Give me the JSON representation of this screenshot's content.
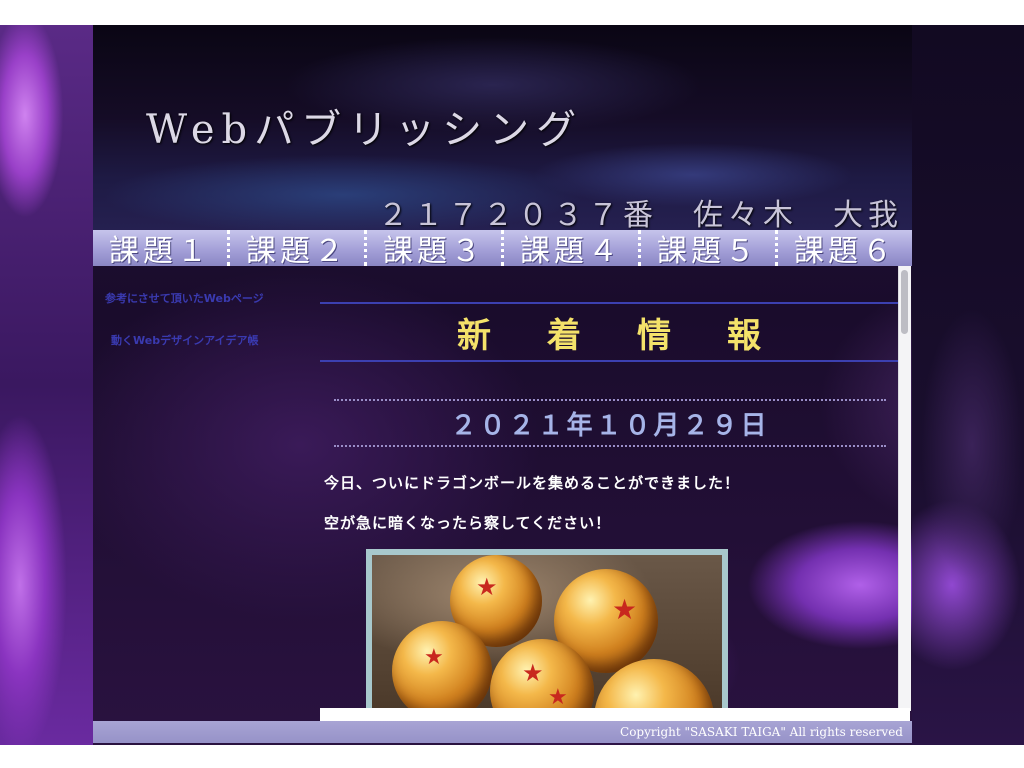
{
  "header": {
    "site_title": "Webパブリッシング",
    "student_info": "２１７２０３７番　佐々木　大我"
  },
  "nav": {
    "tabs": [
      "課題１",
      "課題２",
      "課題３",
      "課題４",
      "課題５",
      "課題６"
    ]
  },
  "sidebar": {
    "links": [
      "参考にさせて頂いたWebページ",
      "動くWebデザインアイデア帳"
    ]
  },
  "main": {
    "heading": "新着情報",
    "date": "２０２１年１０月２９日",
    "paragraphs": [
      "今日、ついにドラゴンボールを集めることができました！",
      "空が急に暗くなったら察してください！"
    ]
  },
  "footer": {
    "copyright": "Copyright \"SASAKI TAIGA\" All rights reserved"
  },
  "colors": {
    "heading": "#f4e26a",
    "date": "#a6b4e8",
    "tab_bg": "#a4a0d8",
    "footer_bg": "#9692c8",
    "link": "#3a3ab0"
  }
}
